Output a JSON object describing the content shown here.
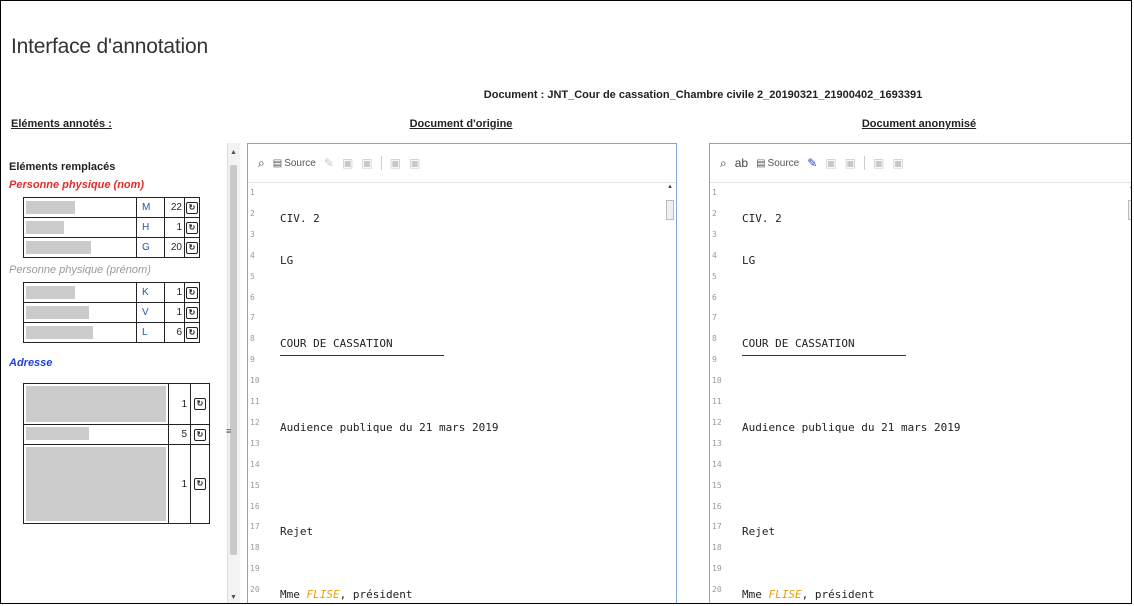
{
  "app": {
    "title": "Interface d'annotation"
  },
  "document": {
    "name": "Document : JNT_Cour de cassation_Chambre civile 2_20190321_21900402_1693391"
  },
  "sidebar": {
    "heading": "Eléments annotés :",
    "replaced_heading": "Eléments remplacés",
    "categories": [
      {
        "label": "Personne physique (nom)",
        "color": "#e32b2b",
        "rows": [
          {
            "code": "M",
            "count": "22",
            "bar": 0.45
          },
          {
            "code": "H",
            "count": "1",
            "bar": 0.35
          },
          {
            "code": "G",
            "count": "20",
            "bar": 0.6
          }
        ]
      },
      {
        "label": "Personne physique (prénom)",
        "color": "#9a9a9a",
        "rows": [
          {
            "code": "K",
            "count": "1",
            "bar": 0.45
          },
          {
            "code": "V",
            "count": "1",
            "bar": 0.58
          },
          {
            "code": "L",
            "count": "6",
            "bar": 0.62
          }
        ]
      },
      {
        "label": "Adresse",
        "color": "#1f3fd6",
        "rows": [
          {
            "count": "1",
            "bar": 1.0
          },
          {
            "count": "5",
            "bar": 0.45
          },
          {
            "count": "1",
            "bar": 1.0
          }
        ]
      }
    ]
  },
  "editors": {
    "original": {
      "heading": "Document d'origine",
      "source_label": "Source",
      "lines": [
        {
          "n": "1",
          "text": ""
        },
        {
          "n": "2",
          "text": "CIV. 2"
        },
        {
          "n": "3",
          "text": ""
        },
        {
          "n": "4",
          "text": "LG"
        },
        {
          "n": "5",
          "text": ""
        },
        {
          "n": "6",
          "text": ""
        },
        {
          "n": "7",
          "text": ""
        },
        {
          "n": "8",
          "text": "COUR DE CASSATION"
        },
        {
          "n": "9",
          "text": ""
        },
        {
          "n": "10",
          "text": ""
        },
        {
          "n": "11",
          "text": ""
        },
        {
          "n": "12",
          "text": "Audience publique du 21 mars 2019"
        },
        {
          "n": "13",
          "text": ""
        },
        {
          "n": "14",
          "text": ""
        },
        {
          "n": "15",
          "text": ""
        },
        {
          "n": "16",
          "text": ""
        },
        {
          "n": "17",
          "text": "Rejet"
        },
        {
          "n": "18",
          "text": ""
        },
        {
          "n": "19",
          "text": ""
        },
        {
          "n": "20",
          "text": "Mme ",
          "highlight": "FLISE",
          "suffix": ", président"
        }
      ]
    },
    "anonymized": {
      "heading": "Document anonymisé",
      "source_label": "Source",
      "lines": [
        {
          "n": "1",
          "text": ""
        },
        {
          "n": "2",
          "text": "CIV. 2"
        },
        {
          "n": "3",
          "text": ""
        },
        {
          "n": "4",
          "text": "LG"
        },
        {
          "n": "5",
          "text": ""
        },
        {
          "n": "6",
          "text": ""
        },
        {
          "n": "7",
          "text": ""
        },
        {
          "n": "8",
          "text": "COUR DE CASSATION"
        },
        {
          "n": "9",
          "text": ""
        },
        {
          "n": "10",
          "text": ""
        },
        {
          "n": "11",
          "text": ""
        },
        {
          "n": "12",
          "text": "Audience publique du 21 mars 2019"
        },
        {
          "n": "13",
          "text": ""
        },
        {
          "n": "14",
          "text": ""
        },
        {
          "n": "15",
          "text": ""
        },
        {
          "n": "16",
          "text": ""
        },
        {
          "n": "17",
          "text": "Rejet"
        },
        {
          "n": "18",
          "text": ""
        },
        {
          "n": "19",
          "text": ""
        },
        {
          "n": "20",
          "text": "Mme ",
          "highlight": "FLISE",
          "suffix": ", président"
        }
      ]
    }
  }
}
